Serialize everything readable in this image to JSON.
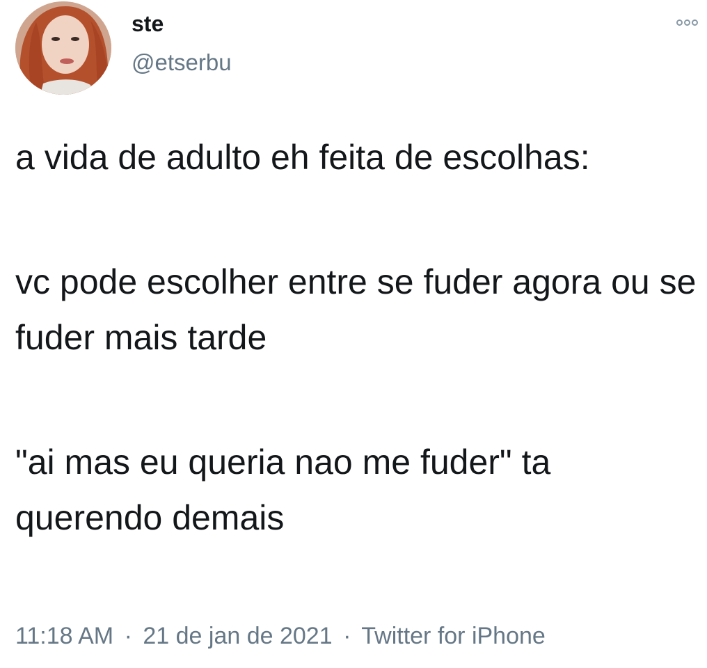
{
  "user": {
    "display_name": "ste",
    "handle": "@etserbu"
  },
  "header": {
    "more_icon": "more-options-icon"
  },
  "tweet": {
    "paragraphs": [
      "a vida de adulto eh feita de escolhas:",
      "vc pode escolher entre se fuder agora ou se fuder mais tarde",
      "\"ai mas eu queria nao me fuder\" ta querendo demais"
    ],
    "time": "11:18 AM",
    "date": "21 de jan de 2021",
    "source": "Twitter for iPhone",
    "separator": "·"
  },
  "colors": {
    "text": "#14171a",
    "secondary": "#657786"
  }
}
